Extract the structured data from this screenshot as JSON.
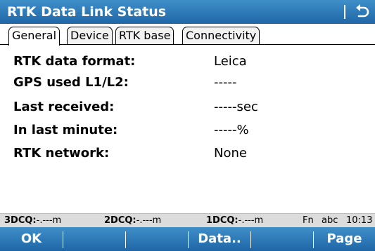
{
  "window": {
    "title": "RTK Data Link Status"
  },
  "tabs": [
    {
      "label": "General",
      "active": true
    },
    {
      "label": "Device",
      "active": false
    },
    {
      "label": "RTK base",
      "active": false
    },
    {
      "label": "Connectivity",
      "active": false
    }
  ],
  "fields": [
    {
      "label": "RTK data format:",
      "value": "Leica"
    },
    {
      "label": "GPS used L1/L2:",
      "value": "-----"
    },
    {
      "label": "Last received:",
      "value": "-----sec"
    },
    {
      "label": "In last minute:",
      "value": "-----%"
    },
    {
      "label": "RTK network:",
      "value": "None"
    }
  ],
  "status": {
    "q3d_label": "3DCQ:",
    "q3d_value": "-.---m",
    "q2d_label": "2DCQ:",
    "q2d_value": "-.---m",
    "q1d_label": "1DCQ:",
    "q1d_value": "-.---m",
    "fn": "Fn",
    "input_mode": "abc",
    "time": "10:13"
  },
  "softkeys": {
    "f1": "OK",
    "f2": "",
    "f3": "",
    "f4": "Data..",
    "f5": "",
    "f6": "Page"
  },
  "colors": {
    "bar_top": "#3f8fc9",
    "bar_bottom": "#1f66a6",
    "statusbar": "#dcdcdc"
  },
  "icons": {
    "back": "back-arrow-icon"
  }
}
